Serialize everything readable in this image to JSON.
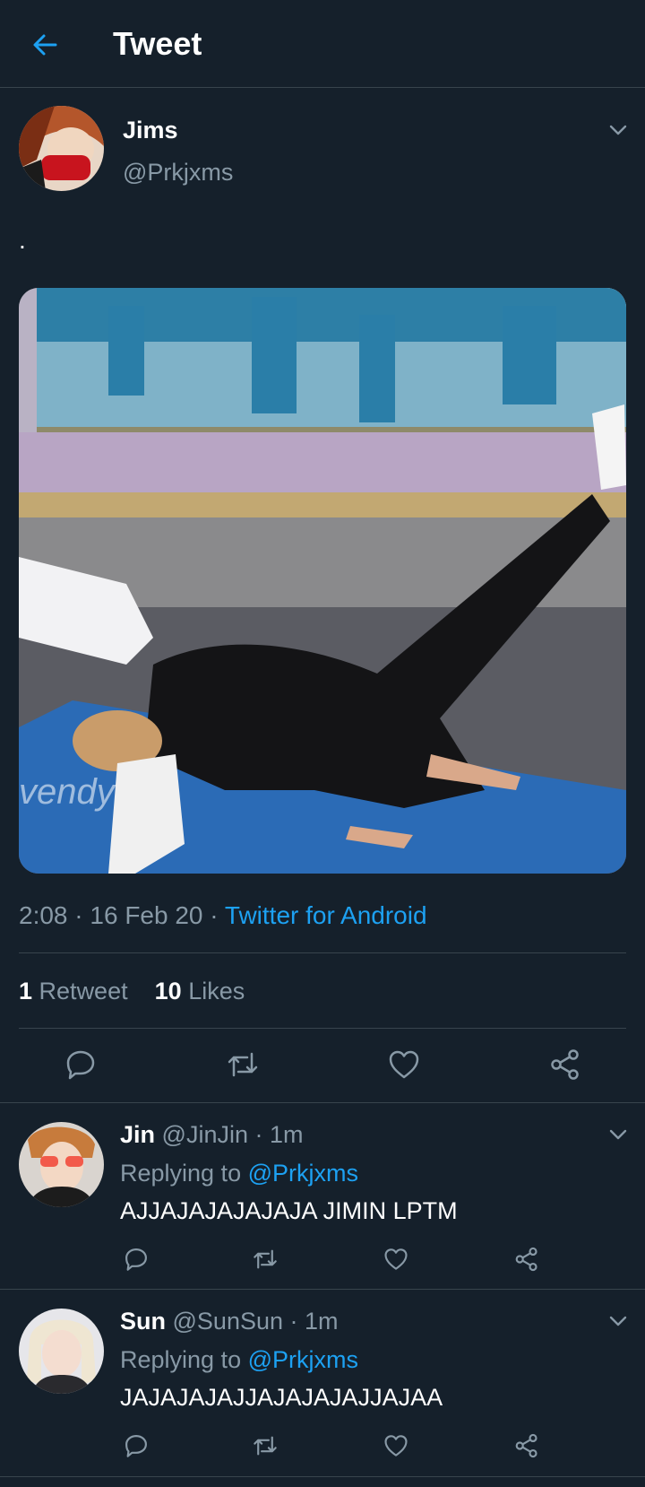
{
  "header": {
    "title": "Tweet",
    "back_icon": "arrow-left-icon"
  },
  "tweet": {
    "author_name": "Jims",
    "author_handle": "@Prkjxms",
    "text": ".",
    "media_watermark": "vendy",
    "time": "2:08",
    "date": "16 Feb 20",
    "source": "Twitter for Android",
    "retweet_count": "1",
    "retweet_label": "Retweet",
    "like_count": "10",
    "like_label": "Likes"
  },
  "replies": [
    {
      "name": "Jin",
      "handle": "@JinJin",
      "time": "1m",
      "replying_label": "Replying to",
      "replying_to": "@Prkjxms",
      "text": "AJJAJAJAJAJAJA JIMIN LPTM"
    },
    {
      "name": "Sun",
      "handle": "@SunSun",
      "time": "1m",
      "replying_label": "Replying to",
      "replying_to": "@Prkjxms",
      "text": "JAJAJAJAJJAJAJAJAJJAJAA"
    }
  ],
  "colors": {
    "background": "#15202b",
    "accent": "#1da1f2",
    "secondary_text": "#8899a6",
    "divider": "#38444d"
  }
}
